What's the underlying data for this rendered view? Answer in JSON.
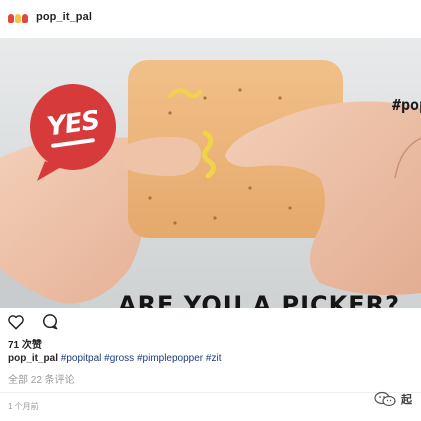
{
  "post": {
    "username": "pop_it_pal",
    "photo": {
      "badge_text": "YES",
      "overlay_hashtag": "#popitpal",
      "headline": "ARE YOU A PICKER?"
    },
    "likes": "71 次赞",
    "caption": {
      "username": "pop_it_pal",
      "tags": [
        "#popitpal",
        "#gross",
        "#pimplepopper",
        "#zit"
      ]
    },
    "comments_link": "全部 22 条评论",
    "timestamp": "1 个月前"
  },
  "actions": {
    "like_icon": "heart-icon",
    "comment_icon": "comment-icon"
  },
  "watermark": {
    "icon": "wechat-icon",
    "text": "起"
  },
  "colors": {
    "hashtag_link": "#1a3d7c",
    "badge_red": "#d63a3a",
    "muted_text": "#999999"
  }
}
